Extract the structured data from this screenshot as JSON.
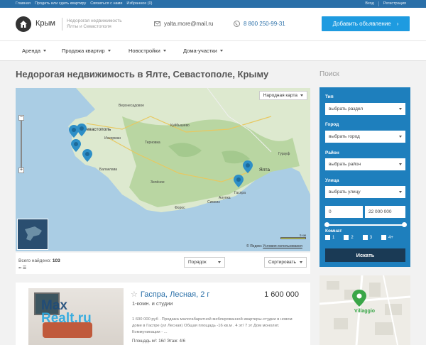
{
  "topbar": {
    "links": [
      "Главная",
      "Продать или сдать квартиру",
      "Связаться с нами",
      "Избранное (0)"
    ],
    "login": "Вход",
    "register": "Регистрация"
  },
  "header": {
    "brand": "Крым",
    "description": "Недорогая недвижимость Ялты и Севастополя",
    "email": "yalta.more@mail.ru",
    "phone": "8 800 250-99-31",
    "add_button": "Добавить объявление"
  },
  "nav": [
    "Аренда",
    "Продажа квартир",
    "Новостройки",
    "Дома-участки"
  ],
  "page_title": "Недорогая недвижимость в Ялте, Севастополе, Крыму",
  "map": {
    "type_label": "Народная карта",
    "labels": {
      "sevastopol": "Севастополь",
      "inkerman": "Инкерман",
      "balaklava": "Балаклава",
      "foros": "Форос",
      "yalta": "Ялта",
      "gaspra": "Гаспра",
      "alupka": "Алупка",
      "simeiz": "Симеиз",
      "gurzuf": "Гурзуф",
      "verkhnesadovoe": "Верхнесадовое",
      "kuibyshevo": "Куйбышево",
      "ternovka": "Терновка",
      "zelenoe": "Зелёное"
    },
    "scale": "5 км",
    "copyright": "© Яндекс",
    "terms": "Условия использования"
  },
  "list": {
    "found_label": "Всего найдено:",
    "found_count": "103",
    "sort_label": "Порядок",
    "sorting_label": "Сортировать"
  },
  "listing": {
    "title": "Гаспра, Лесная, 2 г",
    "subtitle": "1-комн. и студии",
    "price": "1 600 000",
    "description": "1 600 000 руб . Продажа малогабаритной  меблированной квартиры-студии в новом доме в Гаспре (ул Лесная) Общая площадь -16 кв.м . 4 эт/ 7 эт Дом монолит. Коммуникации - ...",
    "area": "Площадь м²: 16//  Этаж: 4/6",
    "watermark_line1": "Max",
    "watermark_line2": "Realt.ru"
  },
  "search": {
    "title": "Поиск",
    "type_label": "Тип",
    "type_value": "выбрать раздел",
    "city_label": "Город",
    "city_value": "выбрать город",
    "district_label": "Район",
    "district_value": "выбрать район",
    "street_label": "Улица",
    "street_value": "выбрать улицу",
    "price_from": "0",
    "price_to": "22 000 000",
    "rooms_label": "Комнат",
    "rooms": [
      "1",
      "2",
      "3",
      "4+"
    ],
    "button": "Искать"
  },
  "map_card": {
    "place": "Villaggio"
  },
  "colors": {
    "accent": "#1e9be0",
    "panel": "#1e7fbd",
    "topbar": "#2a6fa8",
    "pin": "#2e8fc7",
    "search_button": "#1a3a55"
  }
}
